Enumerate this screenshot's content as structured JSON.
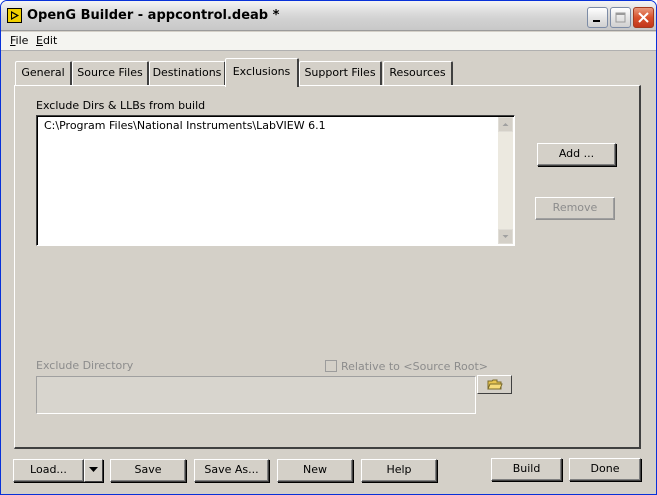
{
  "window": {
    "title": "OpenG Builder - appcontrol.deab *"
  },
  "menu": {
    "file": "File",
    "file_rest": "ile",
    "file_mn": "F",
    "edit_mn": "E",
    "edit_rest": "dit"
  },
  "tabs": [
    {
      "label": "General"
    },
    {
      "label": "Source Files"
    },
    {
      "label": "Destinations"
    },
    {
      "label": "Exclusions"
    },
    {
      "label": "Support Files"
    },
    {
      "label": "Resources"
    }
  ],
  "active_tab": "Exclusions",
  "exclusions": {
    "list_label": "Exclude Dirs & LLBs from build",
    "items": [
      "C:\\Program Files\\National Instruments\\LabVIEW 6.1"
    ],
    "add_label": "Add ...",
    "remove_label": "Remove",
    "dir_label": "Exclude Directory",
    "relative_label": "Relative to <Source Root>",
    "relative_checked": false,
    "dir_value": ""
  },
  "footer": {
    "load_label": "Load...",
    "save_label": "Save",
    "save_as_label": "Save As...",
    "new_label": "New",
    "help_label": "Help",
    "build_label": "Build",
    "done_label": "Done"
  },
  "colors": {
    "titlebar_border": "#0831d9",
    "close_button": "#d8512c",
    "window_bg": "#d4d0c8"
  }
}
